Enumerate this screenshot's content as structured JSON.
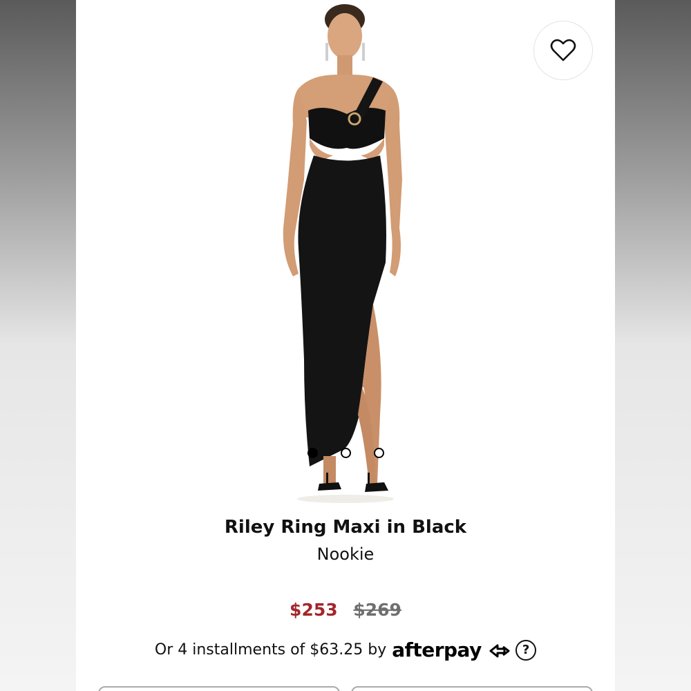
{
  "product": {
    "title": "Riley Ring Maxi in Black",
    "brand": "Nookie",
    "image_alt": "Model wearing black one-shoulder ring maxi dress with side slit",
    "favorite_icon": "heart-icon"
  },
  "carousel": {
    "count": 3,
    "active_index": 0
  },
  "pricing": {
    "sale_price": "$253",
    "original_price": "$269",
    "sale_color": "#a3262a"
  },
  "installments": {
    "text": "Or 4 installments of $63.25 by",
    "provider": "afterpay",
    "help_icon": "question-icon"
  }
}
